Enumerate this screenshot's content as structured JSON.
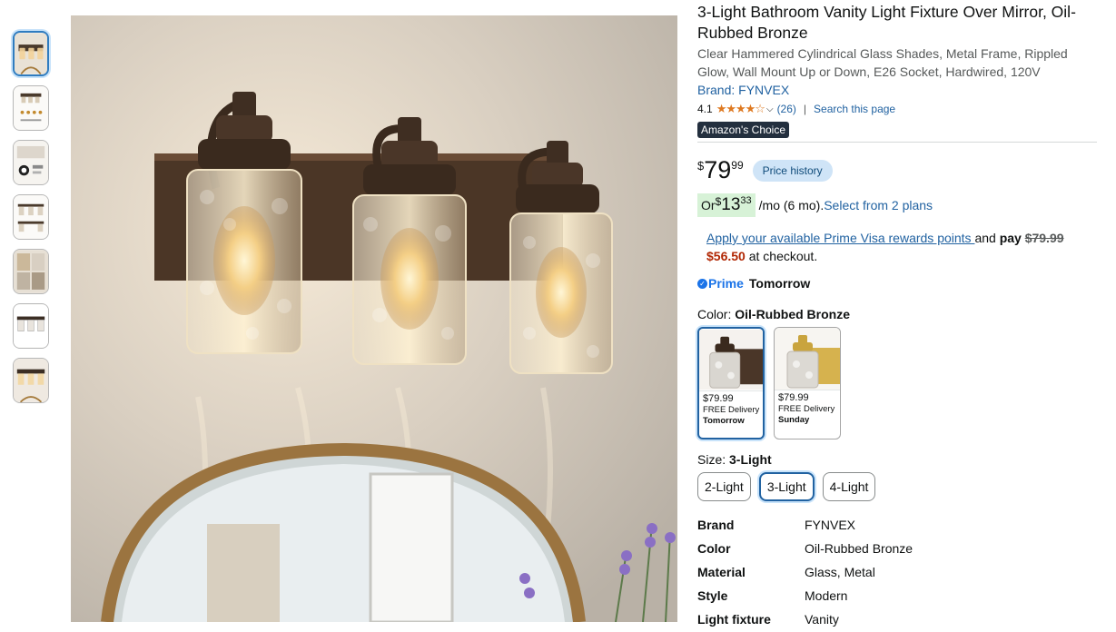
{
  "product": {
    "title": "3-Light Bathroom Vanity Light Fixture Over Mirror, Oil-Rubbed Bronze",
    "subtitle": "Clear Hammered Cylindrical Glass Shades, Metal Frame, Rippled Glow, Wall Mount Up or Down, E26 Socket, Hardwired, 120V",
    "brand_link": "Brand: FYNVEX"
  },
  "rating": {
    "value": "4.1",
    "stars": "★★★★☆",
    "chevron": "⌵",
    "count": "(26)",
    "separator": "|",
    "search_link": "Search this page"
  },
  "badge": "Amazon's Choice",
  "price": {
    "symbol": "$",
    "whole": "79",
    "fraction": "99",
    "history_button": "Price history"
  },
  "monthly": {
    "prefix": "Or ",
    "symbol": "$",
    "whole": "13",
    "fraction": "33",
    "term": "/mo (6 mo). ",
    "plans_link": "Select from 2 plans"
  },
  "visa_offer": {
    "link": "Apply your available Prime Visa rewards points ",
    "and": "and ",
    "pay": "pay ",
    "original": "$79.99",
    "discounted": "$56.50",
    "suffix": " at checkout."
  },
  "delivery": {
    "prime_label": "Prime",
    "when": "Tomorrow"
  },
  "color": {
    "label": "Color: ",
    "selected": "Oil-Rubbed Bronze",
    "options": [
      {
        "price": "$79.99",
        "delivery": "FREE Delivery",
        "when": "Tomorrow"
      },
      {
        "price": "$79.99",
        "delivery": "FREE Delivery",
        "when": "Sunday"
      }
    ]
  },
  "size": {
    "label": "Size: ",
    "selected": "3-Light",
    "options": [
      "2-Light",
      "3-Light",
      "4-Light"
    ]
  },
  "specs": [
    {
      "key": "Brand",
      "value": "FYNVEX"
    },
    {
      "key": "Color",
      "value": "Oil-Rubbed Bronze"
    },
    {
      "key": "Material",
      "value": "Glass, Metal"
    },
    {
      "key": "Style",
      "value": "Modern"
    },
    {
      "key": "Light fixture",
      "value": "Vanity"
    }
  ],
  "icons": {
    "share": "share-icon",
    "prime_check": "✓"
  },
  "colors": {
    "link": "#2162a1",
    "star": "#de7921",
    "deal_red": "#b12704",
    "badge_bg": "#232f3e",
    "prime_blue": "#1a73e8"
  }
}
